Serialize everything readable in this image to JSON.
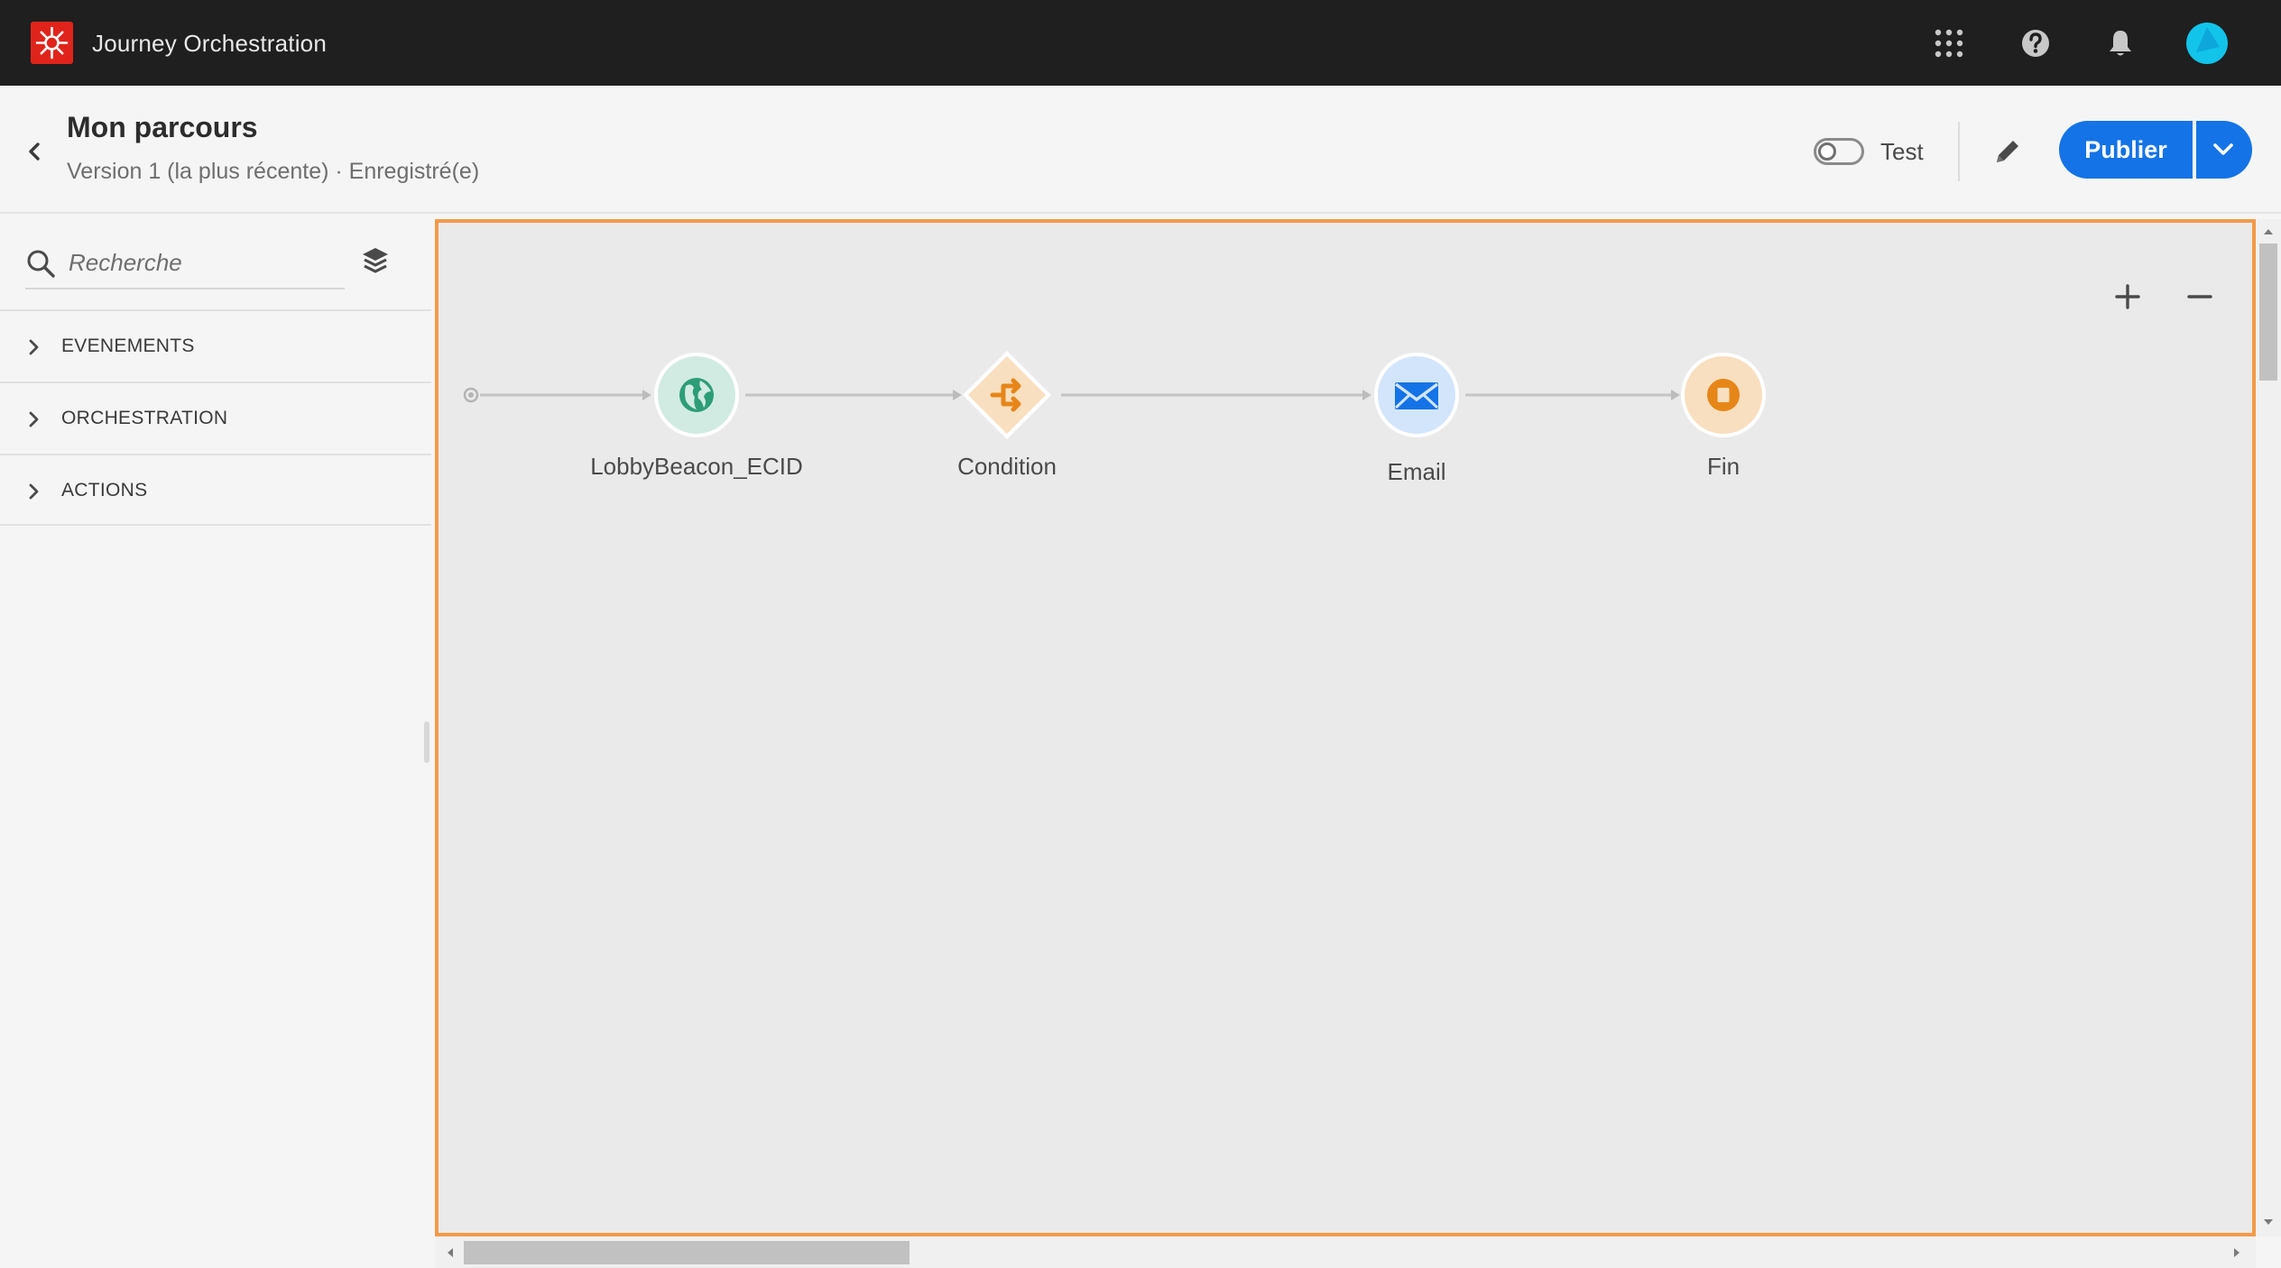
{
  "app": {
    "title": "Journey Orchestration",
    "brand_color": "#e0241b",
    "topbar_icons": [
      "apps-grid-icon",
      "help-icon",
      "bell-icon",
      "avatar"
    ]
  },
  "header": {
    "journey_name": "Mon parcours",
    "version_text": "Version 1 (la plus récente) · Enregistré(e)",
    "test_label": "Test",
    "test_enabled": false,
    "publish_label": "Publier",
    "accent_color": "#1473e6"
  },
  "sidebar": {
    "search_placeholder": "Recherche",
    "categories": [
      {
        "label": "EVENEMENTS"
      },
      {
        "label": "ORCHESTRATION"
      },
      {
        "label": "ACTIONS"
      }
    ]
  },
  "canvas": {
    "border_color": "#f29a49",
    "nodes": [
      {
        "label": "LobbyBeacon_ECID",
        "icon": "globe-icon",
        "color": "#2d9d78"
      },
      {
        "label": "Condition",
        "icon": "condition-icon",
        "color": "#e68619"
      },
      {
        "label": "Email",
        "icon": "email-icon",
        "color": "#1473e6"
      },
      {
        "label": "Fin",
        "icon": "stop-icon",
        "color": "#e68619"
      }
    ]
  }
}
